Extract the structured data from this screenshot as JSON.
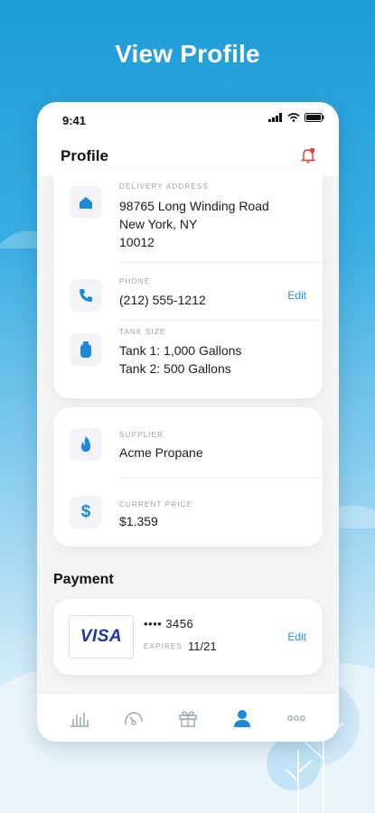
{
  "hero": {
    "title": "View Profile"
  },
  "status_bar": {
    "time": "9:41"
  },
  "header": {
    "title": "Profile"
  },
  "address": {
    "label": "DELIVERY ADDRESS",
    "line1": "98765 Long Winding Road",
    "line2": "New York, NY",
    "line3": "10012"
  },
  "phone": {
    "label": "PHONE",
    "value": "(212) 555-1212",
    "edit_label": "Edit"
  },
  "tank": {
    "label": "TANK SIZE",
    "line1": "Tank 1: 1,000 Gallons",
    "line2": "Tank 2: 500 Gallons"
  },
  "supplier": {
    "label": "SUPPLIER",
    "value": "Acme Propane"
  },
  "price": {
    "label": "CURRENT PRICE",
    "value": "$1.359"
  },
  "payment": {
    "section_title": "Payment",
    "brand": "VISA",
    "masked": "•••• 3456",
    "expires_label": "EXPIRES:",
    "expires_value": "11/21",
    "edit_label": "Edit"
  },
  "nav": {
    "items": [
      "usage-icon",
      "gauge-icon",
      "gift-icon",
      "profile-icon",
      "more-icon"
    ],
    "active": "profile-icon"
  },
  "colors": {
    "accent": "#2a8fd6",
    "icon_blue": "#1e88d9",
    "notification_red": "#e53935",
    "visa_blue": "#1a3a94",
    "visa_orange": "#f7a600"
  }
}
